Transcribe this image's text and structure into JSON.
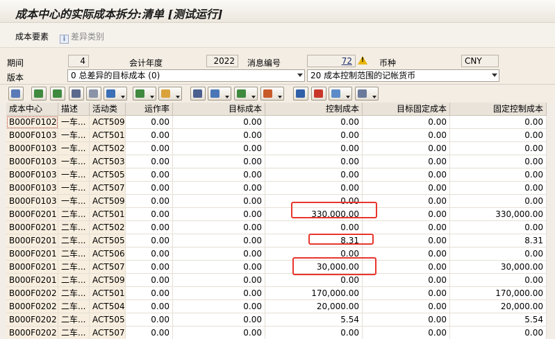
{
  "window": {
    "title": "成本中心的实际成本拆分:清单 [测试运行]"
  },
  "appbar": {
    "cost_element": "成本要素",
    "variance_category": "差异类别"
  },
  "header": {
    "period_label": "期间",
    "period": "4",
    "fiscal_year_label": "会计年度",
    "fiscal_year": "2022",
    "message_label": "消息编号",
    "message_count": "72",
    "currency_label": "币种",
    "currency": "CNY",
    "version_label": "版本",
    "version": "0 总差异的目标成本 (0)",
    "currency_type": "20 成本控制范围的记帐货币"
  },
  "toolbar": {
    "icons": [
      "detail-icon",
      "sort-ascending-icon",
      "sort-descending-icon",
      "find-icon",
      "find-next-icon",
      "filter-icon",
      "sum-icon",
      "subtotal-icon",
      "print-icon",
      "view-icon",
      "export-icon",
      "layout-icon",
      "info-icon",
      "abc-analysis-icon",
      "graphic-icon",
      "settings-icon"
    ]
  },
  "table": {
    "columns": [
      "成本中心",
      "描述",
      "活动类",
      "运作率",
      "目标成本",
      "控制成本",
      "目标固定成本",
      "固定控制成本"
    ],
    "rows": [
      [
        "B000F0102",
        "一车...",
        "ACT509",
        "0.00",
        "0.00",
        "0.00",
        "0.00",
        "0.00"
      ],
      [
        "B000F0103",
        "一车...",
        "ACT501",
        "0.00",
        "0.00",
        "0.00",
        "0.00",
        "0.00"
      ],
      [
        "B000F0103",
        "一车...",
        "ACT502",
        "0.00",
        "0.00",
        "0.00",
        "0.00",
        "0.00"
      ],
      [
        "B000F0103",
        "一车...",
        "ACT503",
        "0.00",
        "0.00",
        "0.00",
        "0.00",
        "0.00"
      ],
      [
        "B000F0103",
        "一车...",
        "ACT505",
        "0.00",
        "0.00",
        "0.00",
        "0.00",
        "0.00"
      ],
      [
        "B000F0103",
        "一车...",
        "ACT507",
        "0.00",
        "0.00",
        "0.00",
        "0.00",
        "0.00"
      ],
      [
        "B000F0103",
        "一车...",
        "ACT509",
        "0.00",
        "0.00",
        "0.00",
        "0.00",
        "0.00"
      ],
      [
        "B000F0201",
        "二车...",
        "ACT501",
        "0.00",
        "0.00",
        "330,000.00",
        "0.00",
        "330,000.00"
      ],
      [
        "B000F0201",
        "二车...",
        "ACT502",
        "0.00",
        "0.00",
        "0.00",
        "0.00",
        "0.00"
      ],
      [
        "B000F0201",
        "二车...",
        "ACT505",
        "0.00",
        "0.00",
        "8.31",
        "0.00",
        "8.31"
      ],
      [
        "B000F0201",
        "二车...",
        "ACT506",
        "0.00",
        "0.00",
        "0.00",
        "0.00",
        "0.00"
      ],
      [
        "B000F0201",
        "二车...",
        "ACT507",
        "0.00",
        "0.00",
        "30,000.00",
        "0.00",
        "30,000.00"
      ],
      [
        "B000F0201",
        "二车...",
        "ACT509",
        "0.00",
        "0.00",
        "0.00",
        "0.00",
        "0.00"
      ],
      [
        "B000F0202",
        "二车...",
        "ACT501",
        "0.00",
        "0.00",
        "170,000.00",
        "0.00",
        "170,000.00"
      ],
      [
        "B000F0202",
        "二车...",
        "ACT504",
        "0.00",
        "0.00",
        "20,000.00",
        "0.00",
        "20,000.00"
      ],
      [
        "B000F0202",
        "二车...",
        "ACT505",
        "0.00",
        "0.00",
        "5.54",
        "0.00",
        "5.54"
      ],
      [
        "B000F0202",
        "二车...",
        "ACT507",
        "0.00",
        "0.00",
        "0.00",
        "0.00",
        "0.00"
      ]
    ],
    "highlighted_rows": [
      7,
      9,
      11
    ]
  },
  "colors": {
    "highlight": "#e8352b",
    "key_column": "#f7eedf",
    "header_bg": "#e9e3da"
  }
}
